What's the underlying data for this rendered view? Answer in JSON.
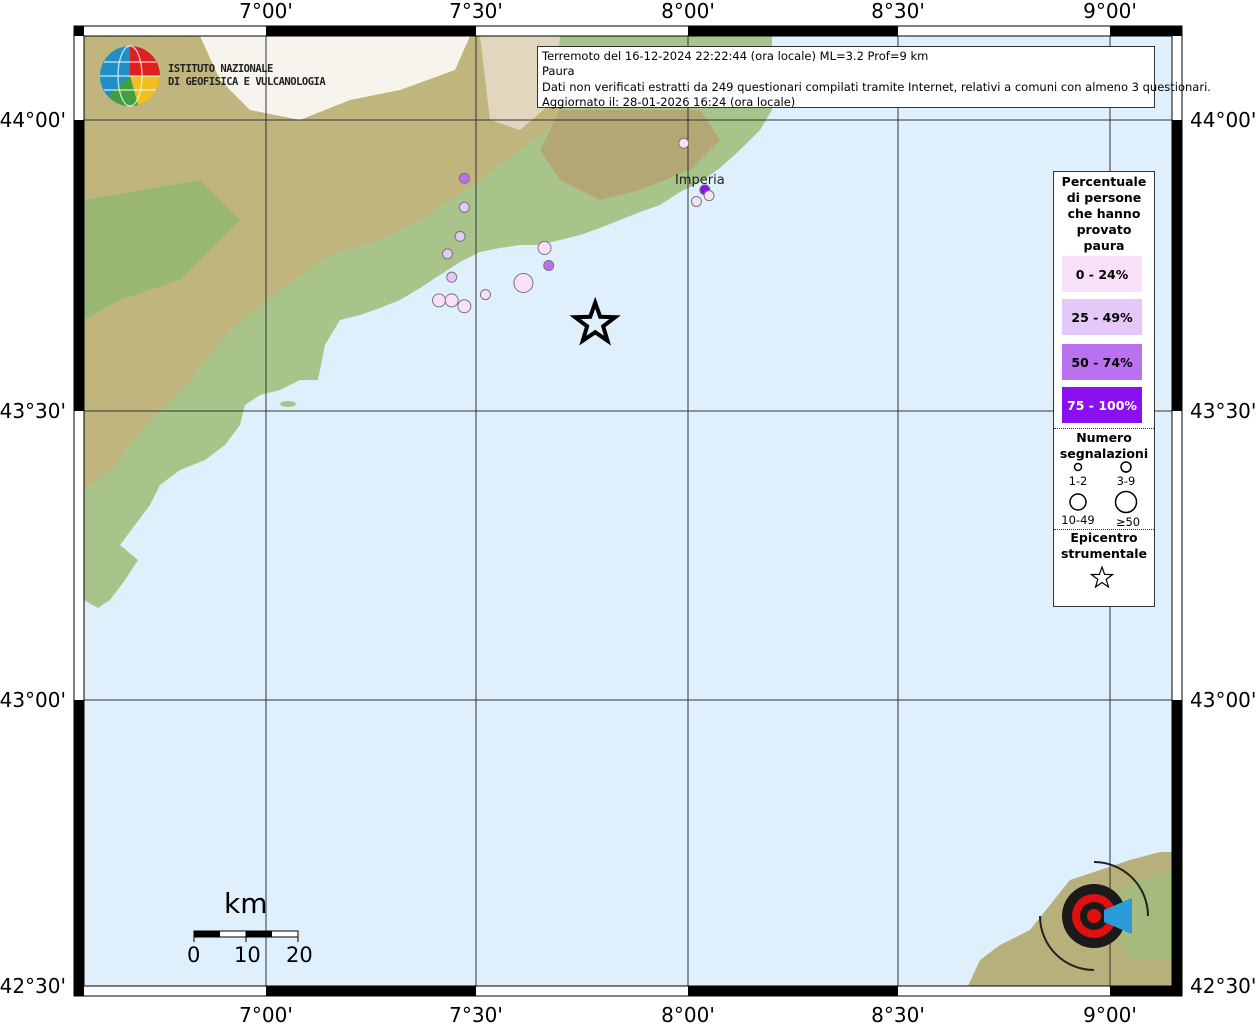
{
  "title_box": {
    "line1": "Terremoto del 16-12-2024 22:22:44 (ora locale) ML=3.2 Prof=9 km",
    "line2": "Paura",
    "line3": "Dati non verificati estratti da 249 questionari compilati tramite Internet, relativi a comuni con almeno 3 questionari.",
    "line4": "Aggiornato il: 28-01-2026 16:24 (ora locale)"
  },
  "logo": {
    "line1": "ISTITUTO NAZIONALE",
    "line2": "DI GEOFISICA E VULCANOLOGIA"
  },
  "axes": {
    "lon_ticks": [
      "7°00'",
      "7°30'",
      "8°00'",
      "8°30'",
      "9°00'"
    ],
    "lat_ticks": [
      "44°00'",
      "43°30'",
      "43°00'",
      "42°30'"
    ]
  },
  "legend": {
    "title": "Percentuale di persone che hanno provato paura",
    "classes": [
      {
        "label": "0 - 24%",
        "color": "#f8e0f8"
      },
      {
        "label": "25 - 49%",
        "color": "#e4c8f8"
      },
      {
        "label": "50 - 74%",
        "color": "#bb70f0"
      },
      {
        "label": "75 - 100%",
        "color": "#8b10f0"
      }
    ],
    "count_title": "Numero segnalazioni",
    "sizes": [
      "1-2",
      "3-9",
      "10-49",
      "≥50"
    ],
    "epicenter_title": "Epicentro strumentale"
  },
  "scale": {
    "unit": "km",
    "labels": [
      "0",
      "10",
      "20"
    ]
  },
  "places": [
    {
      "name": "Imperia"
    }
  ],
  "epicenter": {
    "lon": 7.78,
    "lat": 43.65
  },
  "observations": [
    {
      "lon": 7.41,
      "lat": 43.69,
      "class": 0,
      "size": "3-9"
    },
    {
      "lon": 7.44,
      "lat": 43.69,
      "class": 0,
      "size": "3-9"
    },
    {
      "lon": 7.47,
      "lat": 43.68,
      "class": 0,
      "size": "3-9"
    },
    {
      "lon": 7.52,
      "lat": 43.7,
      "class": 0,
      "size": "1-2"
    },
    {
      "lon": 7.61,
      "lat": 43.72,
      "class": 0,
      "size": "10-49"
    },
    {
      "lon": 7.47,
      "lat": 43.85,
      "class": 1,
      "size": "1-2"
    },
    {
      "lon": 7.46,
      "lat": 43.8,
      "class": 1,
      "size": "1-2"
    },
    {
      "lon": 7.43,
      "lat": 43.77,
      "class": 1,
      "size": "1-2"
    },
    {
      "lon": 7.44,
      "lat": 43.73,
      "class": 1,
      "size": "1-2"
    },
    {
      "lon": 7.66,
      "lat": 43.78,
      "class": 0,
      "size": "3-9"
    },
    {
      "lon": 7.67,
      "lat": 43.75,
      "class": 2,
      "size": "1-2"
    },
    {
      "lon": 7.47,
      "lat": 43.9,
      "class": 2,
      "size": "1-2"
    },
    {
      "lon": 7.99,
      "lat": 43.96,
      "class": 0,
      "size": "1-2"
    },
    {
      "lon": 8.04,
      "lat": 43.88,
      "class": 3,
      "size": "1-2"
    },
    {
      "lon": 8.02,
      "lat": 43.86,
      "class": 0,
      "size": "1-2"
    },
    {
      "lon": 8.05,
      "lat": 43.87,
      "class": 0,
      "size": "1-2"
    }
  ]
}
